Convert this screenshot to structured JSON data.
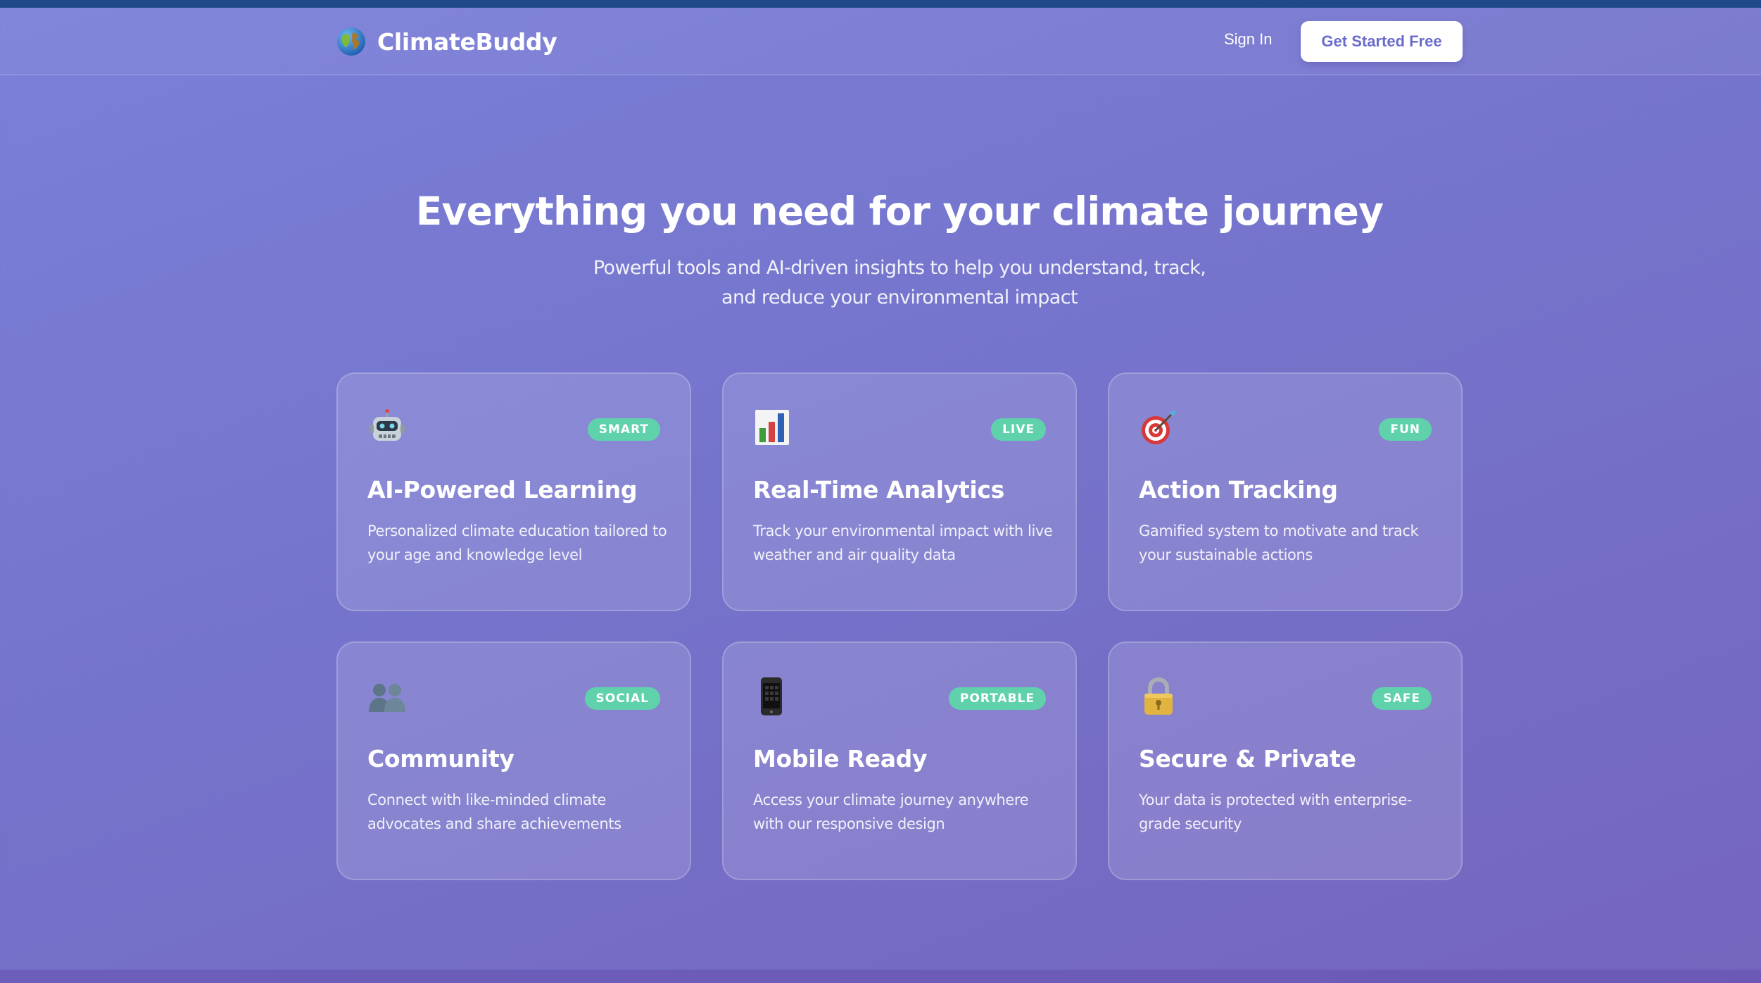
{
  "nav": {
    "brand_icon": "globe-icon",
    "brand_name": "ClimateBuddy",
    "sign_in_label": "Sign In",
    "cta_label": "Get Started Free"
  },
  "hero": {
    "title": "Everything you need for your climate journey",
    "subtitle": "Powerful tools and AI-driven insights to help you understand, track, and reduce your environmental impact"
  },
  "features": [
    {
      "icon": "robot-icon",
      "badge": "SMART",
      "title": "AI-Powered Learning",
      "description": "Personalized climate education tailored to your age and knowledge level"
    },
    {
      "icon": "bar-chart-icon",
      "badge": "LIVE",
      "title": "Real-Time Analytics",
      "description": "Track your environmental impact with live weather and air quality data"
    },
    {
      "icon": "target-icon",
      "badge": "FUN",
      "title": "Action Tracking",
      "description": "Gamified system to motivate and track your sustainable actions"
    },
    {
      "icon": "people-icon",
      "badge": "SOCIAL",
      "title": "Community",
      "description": "Connect with like-minded climate advocates and share achievements"
    },
    {
      "icon": "mobile-phone-icon",
      "badge": "PORTABLE",
      "title": "Mobile Ready",
      "description": "Access your climate journey anywhere with our responsive design"
    },
    {
      "icon": "padlock-icon",
      "badge": "SAFE",
      "title": "Secure & Private",
      "description": "Your data is protected with enterprise-grade security"
    }
  ],
  "colors": {
    "background_start": "#7b80d8",
    "background_end": "#7565be",
    "top_strip": "#1e4a8a",
    "badge": "#5fd2ac",
    "cta_text": "#6a6ccb"
  }
}
